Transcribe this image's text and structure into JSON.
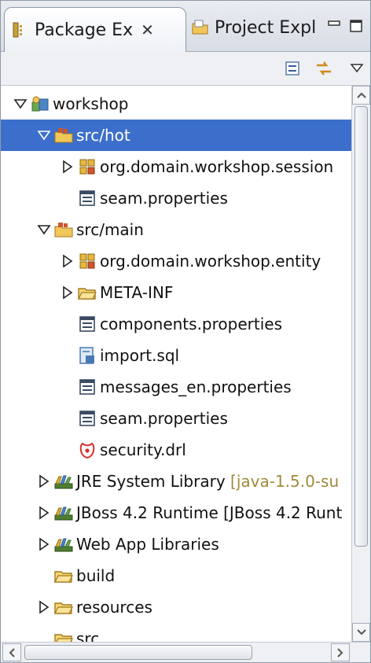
{
  "tabs": [
    {
      "label": "Package Ex",
      "close": "✕"
    },
    {
      "label": "Project Expl"
    }
  ],
  "tree": [
    {
      "label": "workshop",
      "icon": "project-icon",
      "twisty": "expanded"
    },
    {
      "label": "src/hot",
      "icon": "source-folder-icon",
      "twisty": "expanded",
      "selected": true
    },
    {
      "label": "org.domain.workshop.session",
      "icon": "package-icon",
      "twisty": "collapsed"
    },
    {
      "label": "seam.properties",
      "icon": "properties-file-icon",
      "twisty": "none"
    },
    {
      "label": "src/main",
      "icon": "source-folder-icon",
      "twisty": "expanded"
    },
    {
      "label": "org.domain.workshop.entity",
      "icon": "package-icon",
      "twisty": "collapsed"
    },
    {
      "label": "META-INF",
      "icon": "folder-icon",
      "twisty": "collapsed"
    },
    {
      "label": "components.properties",
      "icon": "properties-file-icon",
      "twisty": "none"
    },
    {
      "label": "import.sql",
      "icon": "sql-file-icon",
      "twisty": "none"
    },
    {
      "label": "messages_en.properties",
      "icon": "properties-file-icon",
      "twisty": "none"
    },
    {
      "label": "seam.properties",
      "icon": "properties-file-icon",
      "twisty": "none"
    },
    {
      "label": "security.drl",
      "icon": "drools-file-icon",
      "twisty": "none"
    },
    {
      "label": "JRE System Library",
      "suffix": "[java-1.5.0-su",
      "icon": "library-icon",
      "twisty": "collapsed"
    },
    {
      "label": "JBoss 4.2 Runtime [JBoss 4.2 Runt",
      "icon": "library-icon",
      "twisty": "collapsed"
    },
    {
      "label": "Web App Libraries",
      "icon": "library-icon",
      "twisty": "collapsed"
    },
    {
      "label": "build",
      "icon": "folder-icon",
      "twisty": "none"
    },
    {
      "label": "resources",
      "icon": "folder-icon",
      "twisty": "collapsed"
    },
    {
      "label": "src",
      "icon": "folder-icon",
      "twisty": "none"
    }
  ],
  "colors": {
    "selection": "#3c6fcb",
    "decoration_text": "#a08a3c"
  }
}
